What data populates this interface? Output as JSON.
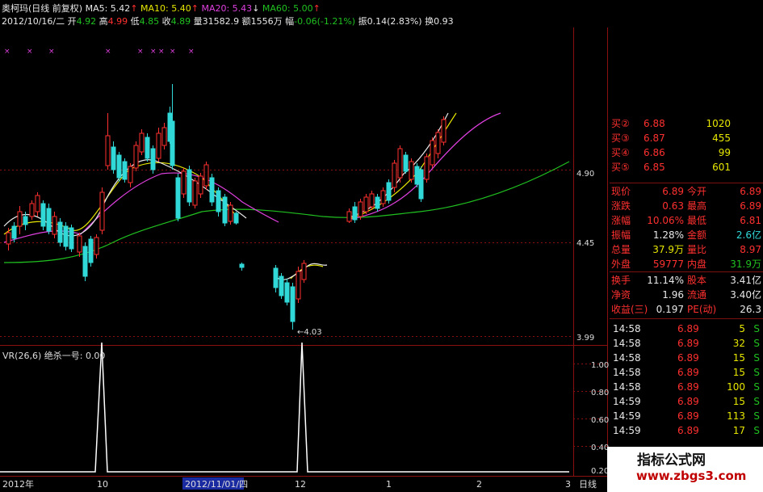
{
  "header": {
    "name": "奥柯玛(日线 前复权)",
    "ma5": "MA5: 5.42",
    "ma10": "MA10: 5.40",
    "ma20": "MA20: 5.43",
    "ma60": "MA60: 5.00",
    "date": "2012/10/16/二",
    "open_lbl": "开",
    "open": "4.92",
    "high_lbl": "高",
    "high": "4.99",
    "low_lbl": "低",
    "low": "4.85",
    "close_lbl": "收",
    "close": "4.89",
    "vol_lbl": "量",
    "vol": "31582.9",
    "amt_lbl": "额",
    "amt": "1556万",
    "chg_lbl": "幅",
    "chg": "-0.06(-1.21%)",
    "amp_lbl": "振",
    "amp": "0.14(2.83%)",
    "turn_lbl": "换",
    "turn": "0.93"
  },
  "price_axis": [
    "4.90",
    "4.45",
    "3.99"
  ],
  "low_annotation": "4.03",
  "indicator": {
    "label": "VR(26,6)  绝杀一号: 0.00",
    "ticks": [
      "1.00",
      "0.80",
      "0.60",
      "0.40",
      "0.20"
    ]
  },
  "time_axis": {
    "labels": [
      "2012年",
      "10",
      "2012/11/01/四",
      "12",
      "1",
      "2",
      "3"
    ],
    "period": "日线"
  },
  "panel": {
    "bids": [
      {
        "label": "买②",
        "price": "6.88",
        "vol": "1020"
      },
      {
        "label": "买③",
        "price": "6.87",
        "vol": "455"
      },
      {
        "label": "买④",
        "price": "6.86",
        "vol": "99"
      },
      {
        "label": "买⑤",
        "price": "6.85",
        "vol": "601"
      }
    ],
    "quote": [
      {
        "l1": "现价",
        "v1": "6.89",
        "l2": "今开",
        "v2": "6.89"
      },
      {
        "l1": "涨跌",
        "v1": "0.63",
        "l2": "最高",
        "v2": "6.89"
      },
      {
        "l1": "涨幅",
        "v1": "10.06%",
        "l2": "最低",
        "v2": "6.81"
      },
      {
        "l1": "振幅",
        "v1": "1.28%",
        "l2": "金额",
        "v2": "2.6亿"
      },
      {
        "l1": "总量",
        "v1": "37.9万",
        "l2": "量比",
        "v2": "8.97"
      },
      {
        "l1": "外盘",
        "v1": "59777",
        "l2": "内盘",
        "v2": "31.9万"
      }
    ],
    "fund": [
      {
        "l1": "换手",
        "v1": "11.14%",
        "l2": "股本",
        "v2": "3.41亿"
      },
      {
        "l1": "净资",
        "v1": "1.96",
        "l2": "流通",
        "v2": "3.40亿"
      },
      {
        "l1": "收益(三)",
        "v1": "0.197",
        "l2": "PE(动)",
        "v2": "26.3"
      }
    ],
    "ticks": [
      {
        "t": "14:58",
        "p": "6.89",
        "v": "5",
        "s": "S"
      },
      {
        "t": "14:58",
        "p": "6.89",
        "v": "32",
        "s": "S"
      },
      {
        "t": "14:58",
        "p": "6.89",
        "v": "15",
        "s": "S"
      },
      {
        "t": "14:58",
        "p": "6.89",
        "v": "15",
        "s": "S"
      },
      {
        "t": "14:58",
        "p": "6.89",
        "v": "100",
        "s": "S"
      },
      {
        "t": "14:59",
        "p": "6.89",
        "v": "15",
        "s": "S"
      },
      {
        "t": "14:59",
        "p": "6.89",
        "v": "113",
        "s": "S"
      },
      {
        "t": "14:59",
        "p": "6.89",
        "v": "17",
        "s": "S"
      }
    ]
  },
  "watermark": {
    "title": "指标公式网",
    "url": "www.zbgs3.com"
  },
  "colors": {
    "up": "#ff3030",
    "down": "#30d8d8",
    "ma5": "#e8e8e8",
    "ma10": "#e6e600",
    "ma20": "#e040e0",
    "ma60": "#20c020",
    "grid": "#8a1010"
  }
}
